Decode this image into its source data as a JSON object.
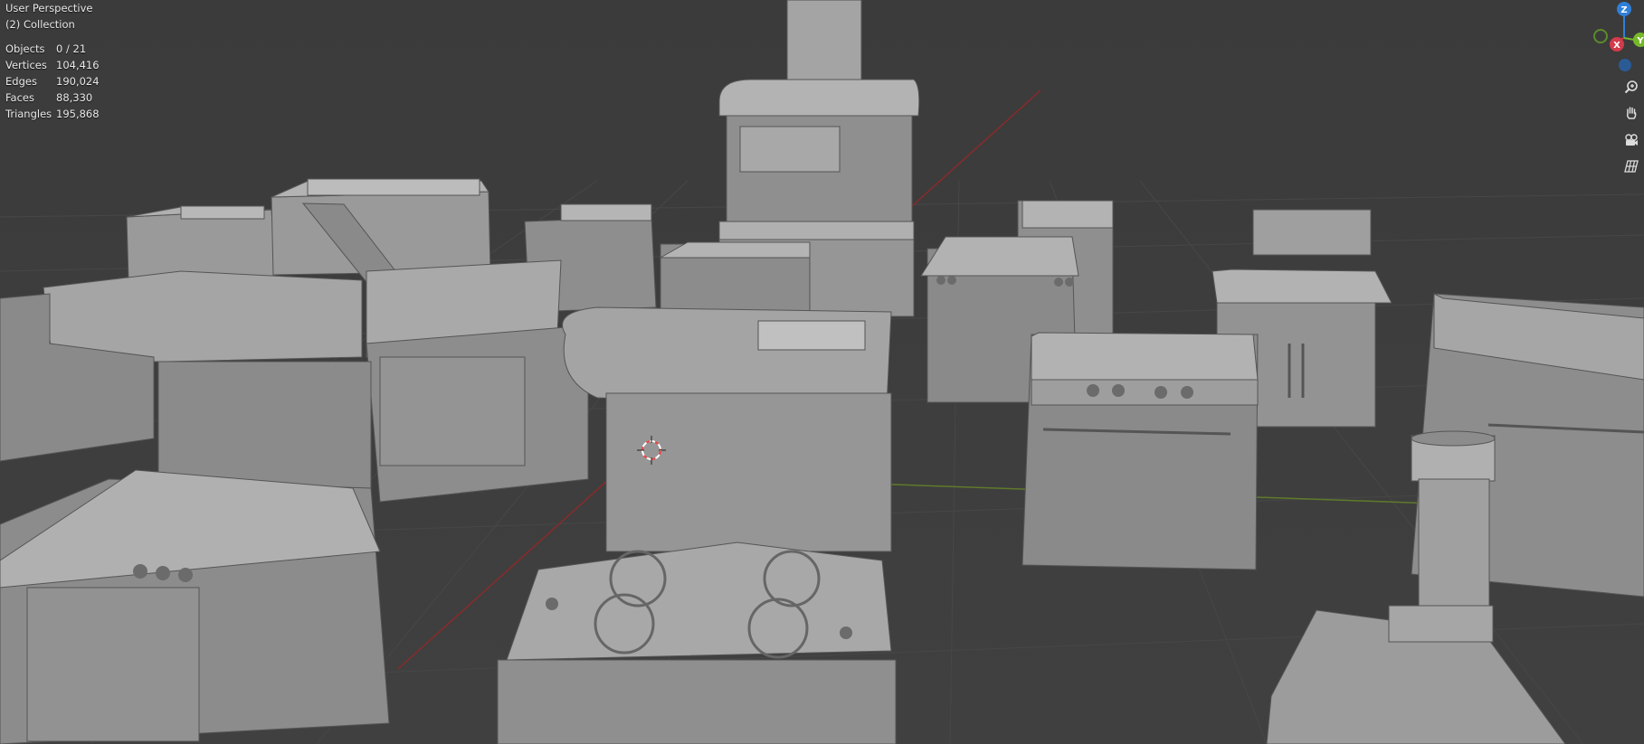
{
  "viewport": {
    "view_name": "User Perspective",
    "collection": "(2) Collection"
  },
  "stats": [
    {
      "label": "Objects",
      "value": "0 / 21"
    },
    {
      "label": "Vertices",
      "value": "104,416"
    },
    {
      "label": "Edges",
      "value": "190,024"
    },
    {
      "label": "Faces",
      "value": "88,330"
    },
    {
      "label": "Triangles",
      "value": "195,868"
    }
  ],
  "gizmo": {
    "z_label": "Z",
    "y_label": "Y",
    "x_label": "X",
    "colors": {
      "x": "#d33b4a",
      "y": "#76b82a",
      "z": "#2f7fd8",
      "neg_y": "#5d8a2c",
      "neg_z": "#2a5b95"
    }
  },
  "nav_buttons": [
    {
      "icon": "zoom-icon"
    },
    {
      "icon": "hand-pan-icon"
    },
    {
      "icon": "camera-icon"
    },
    {
      "icon": "grid-ortho-icon"
    }
  ],
  "colors": {
    "background": "#3d3d3d",
    "grid": "#474747",
    "x_axis": "#8a2a2a",
    "y_axis": "#5f7a2b",
    "model_light": "#a8a8a8",
    "model_mid": "#8e8e8e",
    "model_dark": "#5a5a5a"
  }
}
